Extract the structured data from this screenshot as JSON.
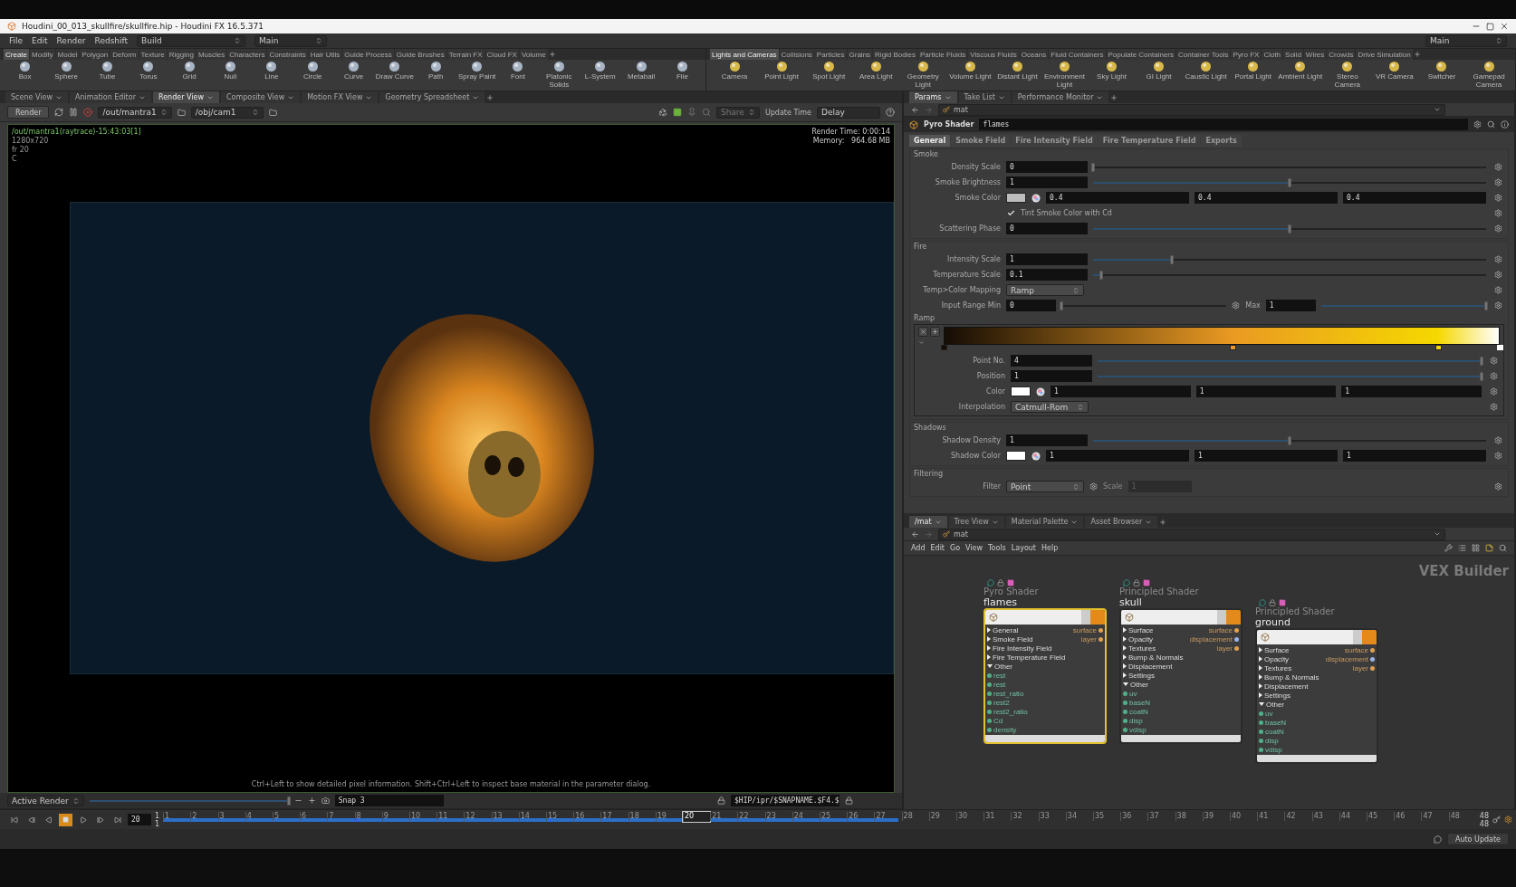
{
  "window": {
    "title": "Houdini_00_013_skullfire/skullfire.hip - Houdini FX 16.5.371"
  },
  "menu_bar": {
    "menus": [
      "File",
      "Edit",
      "Render",
      "Redshift"
    ],
    "shelf_set": "Build",
    "desktop": "Main",
    "right_desktop": "Main"
  },
  "shelves": [
    {
      "tabs": [
        {
          "label": "Create",
          "selected": true
        },
        {
          "label": "Modify",
          "selected": false
        },
        {
          "label": "Model",
          "selected": false
        },
        {
          "label": "Polygon",
          "selected": false
        },
        {
          "label": "Deform",
          "selected": false
        },
        {
          "label": "Texture",
          "selected": false
        },
        {
          "label": "Rigging",
          "selected": false
        },
        {
          "label": "Muscles",
          "selected": false
        },
        {
          "label": "Characters",
          "selected": false
        },
        {
          "label": "Constraints",
          "selected": false
        },
        {
          "label": "Hair Utils",
          "selected": false
        },
        {
          "label": "Guide Process",
          "selected": false
        },
        {
          "label": "Guide Brushes",
          "selected": false
        },
        {
          "label": "Terrain FX",
          "selected": false
        },
        {
          "label": "Cloud FX",
          "selected": false
        },
        {
          "label": "Volume",
          "selected": false
        }
      ],
      "tools": [
        "Box",
        "Sphere",
        "Tube",
        "Torus",
        "Grid",
        "Null",
        "Line",
        "Circle",
        "Curve",
        "Draw Curve",
        "Path",
        "Spray Paint",
        "Font",
        "Platonic Solids",
        "L-System",
        "Metaball",
        "File"
      ]
    },
    {
      "tabs": [
        {
          "label": "Lights and Cameras",
          "selected": true
        },
        {
          "label": "Collisions",
          "selected": false
        },
        {
          "label": "Particles",
          "selected": false
        },
        {
          "label": "Grains",
          "selected": false
        },
        {
          "label": "Rigid Bodies",
          "selected": false
        },
        {
          "label": "Particle Fluids",
          "selected": false
        },
        {
          "label": "Viscous Fluids",
          "selected": false
        },
        {
          "label": "Oceans",
          "selected": false
        },
        {
          "label": "Fluid Containers",
          "selected": false
        },
        {
          "label": "Populate Containers",
          "selected": false
        },
        {
          "label": "Container Tools",
          "selected": false
        },
        {
          "label": "Pyro FX",
          "selected": false
        },
        {
          "label": "Cloth",
          "selected": false
        },
        {
          "label": "Solid",
          "selected": false
        },
        {
          "label": "Wires",
          "selected": false
        },
        {
          "label": "Crowds",
          "selected": false
        },
        {
          "label": "Drive Simulation",
          "selected": false
        }
      ],
      "tools": [
        "Camera",
        "Point Light",
        "Spot Light",
        "Area Light",
        "Geometry Light",
        "Volume Light",
        "Distant Light",
        "Environment Light",
        "Sky Light",
        "GI Light",
        "Caustic Light",
        "Portal Light",
        "Ambient Light",
        "Stereo Camera",
        "VR Camera",
        "Switcher",
        "Gamepad Camera"
      ]
    }
  ],
  "render_view": {
    "tabs": [
      {
        "label": "Scene View",
        "selected": false
      },
      {
        "label": "Animation Editor",
        "selected": false
      },
      {
        "label": "Render View",
        "selected": true
      },
      {
        "label": "Composite View",
        "selected": false
      },
      {
        "label": "Motion FX View",
        "selected": false
      },
      {
        "label": "Geometry Spreadsheet",
        "selected": false
      }
    ],
    "render_button": "Render",
    "driver": "/out/mantra1",
    "camera": "/obj/cam1",
    "share": "Share",
    "update": "Update Time",
    "delay": "Delay",
    "info": [
      "/out/mantra1(raytrace)-15:43:03[1]",
      "1280x720",
      "fr 20",
      "C"
    ],
    "stats": [
      "Render Time: 0:00:14",
      "Memory:   964.68 MB"
    ],
    "hint": "Ctrl+Left to show detailed pixel information. Shift+Ctrl+Left to inspect base material in the parameter dialog.",
    "mode": "Active Render",
    "slider": {
      "level": 1
    },
    "snap": "Snap 3",
    "snap_path": "$HIP/ipr/$SNAPNAME.$F4.$"
  },
  "parameters": {
    "tabs": [
      {
        "label": "Params",
        "selected": true
      },
      {
        "label": "Take List",
        "selected": false
      },
      {
        "label": "Performance Monitor",
        "selected": false
      }
    ],
    "path": "mat",
    "node_type": "Pyro Shader",
    "node_name": "flames",
    "param_tabs": [
      {
        "label": "General",
        "selected": true
      },
      {
        "label": "Smoke Field",
        "selected": false
      },
      {
        "label": "Fire Intensity Field",
        "selected": false
      },
      {
        "label": "Fire Temperature Field",
        "selected": false
      },
      {
        "label": "Exports",
        "selected": false
      }
    ],
    "sections": [
      {
        "title": "Smoke",
        "rows": [
          {
            "kind": "number",
            "label": "Density Scale",
            "value": "0",
            "level": 0
          },
          {
            "kind": "number",
            "label": "Smoke Brightness",
            "value": "1",
            "level": 0.5
          },
          {
            "kind": "color",
            "label": "Smoke Color",
            "color": "#bdbdbd",
            "values": [
              "0.4",
              "0.4",
              "0.4"
            ]
          },
          {
            "kind": "checkbox",
            "label": "Tint Smoke Color with Cd",
            "checked": true
          },
          {
            "kind": "number",
            "label": "Scattering Phase",
            "value": "0",
            "level": 0.5
          }
        ]
      },
      {
        "title": "Fire",
        "rows": [
          {
            "kind": "number",
            "label": "Intensity Scale",
            "value": "1",
            "level": 0.2
          },
          {
            "kind": "number",
            "label": "Temperature Scale",
            "value": "0.1",
            "level": 0.02
          },
          {
            "kind": "menu",
            "label": "Temp>Color Mapping",
            "value": "Ramp"
          },
          {
            "kind": "range",
            "label": "Input Range Min",
            "value": "0",
            "level": 0,
            "max": {
              "label": "Max",
              "value": "1",
              "level": 1
            }
          },
          {
            "kind": "ramp",
            "label": "Ramp",
            "keys": [
              {
                "level": 0,
                "color": "#140c04",
                "selected": false
              },
              {
                "level": 0.52,
                "color": "#ea9a22",
                "selected": false
              },
              {
                "level": 0.89,
                "color": "#f5d800",
                "selected": false
              },
              {
                "level": 1,
                "color": "#ffffff",
                "selected": true
              }
            ],
            "rows": [
              {
                "kind": "number",
                "label": "Point No.",
                "value": "4",
                "level": 1
              },
              {
                "kind": "number",
                "label": "Position",
                "value": "1",
                "level": 1
              },
              {
                "kind": "color",
                "label": "Color",
                "color": "#ffffff",
                "values": [
                  "1",
                  "1",
                  "1"
                ]
              },
              {
                "kind": "menu",
                "label": "Interpolation",
                "value": "Catmull-Rom"
              }
            ]
          }
        ]
      },
      {
        "title": "Shadows",
        "rows": [
          {
            "kind": "number",
            "label": "Shadow Density",
            "value": "1",
            "level": 0.5
          },
          {
            "kind": "color",
            "label": "Shadow Color",
            "color": "#ffffff",
            "values": [
              "1",
              "1",
              "1"
            ]
          }
        ]
      },
      {
        "title": "Filtering",
        "rows": [
          {
            "kind": "menu",
            "label": "Filter",
            "value": "Point",
            "extra_label": "Scale",
            "extra_value": "1",
            "extra_disabled": true
          }
        ]
      }
    ]
  },
  "network": {
    "tabs": [
      {
        "label": "/mat",
        "selected": true
      },
      {
        "label": "Tree View",
        "selected": false
      },
      {
        "label": "Material Palette",
        "selected": false
      },
      {
        "label": "Asset Browser",
        "selected": false
      }
    ],
    "path": "mat",
    "menus": [
      "Add",
      "Edit",
      "Go",
      "View",
      "Tools",
      "Layout",
      "Help"
    ],
    "context": "VEX Builder",
    "nodes": [
      {
        "type": "Pyro Shader",
        "name": "flames",
        "selected": true,
        "sections": [
          {
            "label": "General",
            "expanded": false
          },
          {
            "label": "Smoke Field",
            "expanded": false
          },
          {
            "label": "Fire Intensity Field",
            "expanded": false
          },
          {
            "label": "Fire Temperature Field",
            "expanded": false
          },
          {
            "label": "Other",
            "expanded": true
          }
        ],
        "inputs": [
          "rest",
          "rest",
          "rest_ratio",
          "rest2",
          "rest2_ratio",
          "Cd",
          "density"
        ],
        "outputs": [
          {
            "label": "surface",
            "color": "#e0a050"
          },
          {
            "label": "layer",
            "color": "#e0a050"
          }
        ]
      },
      {
        "type": "Principled Shader",
        "name": "skull",
        "selected": false,
        "sections": [
          {
            "label": "Surface",
            "expanded": false
          },
          {
            "label": "Opacity",
            "expanded": false
          },
          {
            "label": "Textures",
            "expanded": false
          },
          {
            "label": "Bump & Normals",
            "expanded": false
          },
          {
            "label": "Displacement",
            "expanded": false
          },
          {
            "label": "Settings",
            "expanded": false
          },
          {
            "label": "Other",
            "expanded": true
          }
        ],
        "inputs": [
          "uv",
          "baseN",
          "coatN",
          "disp",
          "vdisp"
        ],
        "outputs": [
          {
            "label": "surface",
            "color": "#e0a050"
          },
          {
            "label": "displacement",
            "color": "#9bb4e8"
          },
          {
            "label": "layer",
            "color": "#e0a050"
          }
        ]
      },
      {
        "type": "Principled Shader",
        "name": "ground",
        "selected": false,
        "sections": [
          {
            "label": "Surface",
            "expanded": false
          },
          {
            "label": "Opacity",
            "expanded": false
          },
          {
            "label": "Textures",
            "expanded": false
          },
          {
            "label": "Bump & Normals",
            "expanded": false
          },
          {
            "label": "Displacement",
            "expanded": false
          },
          {
            "label": "Settings",
            "expanded": false
          },
          {
            "label": "Other",
            "expanded": true
          }
        ],
        "inputs": [
          "uv",
          "baseN",
          "coatN",
          "disp",
          "vdisp"
        ],
        "outputs": [
          {
            "label": "surface",
            "color": "#e0a050"
          },
          {
            "label": "displacement",
            "color": "#9bb4e8"
          },
          {
            "label": "layer",
            "color": "#e0a050"
          }
        ]
      }
    ]
  },
  "timeline": {
    "frame": "20",
    "start": [
      "1",
      "1"
    ],
    "end": [
      "48",
      "48"
    ],
    "cache": {
      "level": 0.56
    },
    "ticks": [
      {
        "label": "1",
        "selected": false
      },
      {
        "label": "2",
        "selected": false
      },
      {
        "label": "3",
        "selected": false
      },
      {
        "label": "4",
        "selected": false
      },
      {
        "label": "5",
        "selected": false
      },
      {
        "label": "6",
        "selected": false
      },
      {
        "label": "7",
        "selected": false
      },
      {
        "label": "8",
        "selected": false
      },
      {
        "label": "9",
        "selected": false
      },
      {
        "label": "10",
        "selected": false
      },
      {
        "label": "11",
        "selected": false
      },
      {
        "label": "12",
        "selected": false
      },
      {
        "label": "13",
        "selected": false
      },
      {
        "label": "14",
        "selected": false
      },
      {
        "label": "15",
        "selected": false
      },
      {
        "label": "16",
        "selected": false
      },
      {
        "label": "17",
        "selected": false
      },
      {
        "label": "18",
        "selected": false
      },
      {
        "label": "19",
        "selected": false
      },
      {
        "label": "20",
        "selected": true
      },
      {
        "label": "21",
        "selected": false
      },
      {
        "label": "22",
        "selected": false
      },
      {
        "label": "23",
        "selected": false
      },
      {
        "label": "24",
        "selected": false
      },
      {
        "label": "25",
        "selected": false
      },
      {
        "label": "26",
        "selected": false
      },
      {
        "label": "27",
        "selected": false
      },
      {
        "label": "28",
        "selected": false
      },
      {
        "label": "29",
        "selected": false
      },
      {
        "label": "30",
        "selected": false
      },
      {
        "label": "31",
        "selected": false
      },
      {
        "label": "32",
        "selected": false
      },
      {
        "label": "33",
        "selected": false
      },
      {
        "label": "34",
        "selected": false
      },
      {
        "label": "35",
        "selected": false
      },
      {
        "label": "36",
        "selected": false
      },
      {
        "label": "37",
        "selected": false
      },
      {
        "label": "38",
        "selected": false
      },
      {
        "label": "39",
        "selected": false
      },
      {
        "label": "40",
        "selected": false
      },
      {
        "label": "41",
        "selected": false
      },
      {
        "label": "42",
        "selected": false
      },
      {
        "label": "43",
        "selected": false
      },
      {
        "label": "44",
        "selected": false
      },
      {
        "label": "45",
        "selected": false
      },
      {
        "label": "46",
        "selected": false
      },
      {
        "label": "47",
        "selected": false
      },
      {
        "label": "48",
        "selected": false
      }
    ]
  },
  "status_bar": {
    "auto_update": "Auto Update"
  }
}
